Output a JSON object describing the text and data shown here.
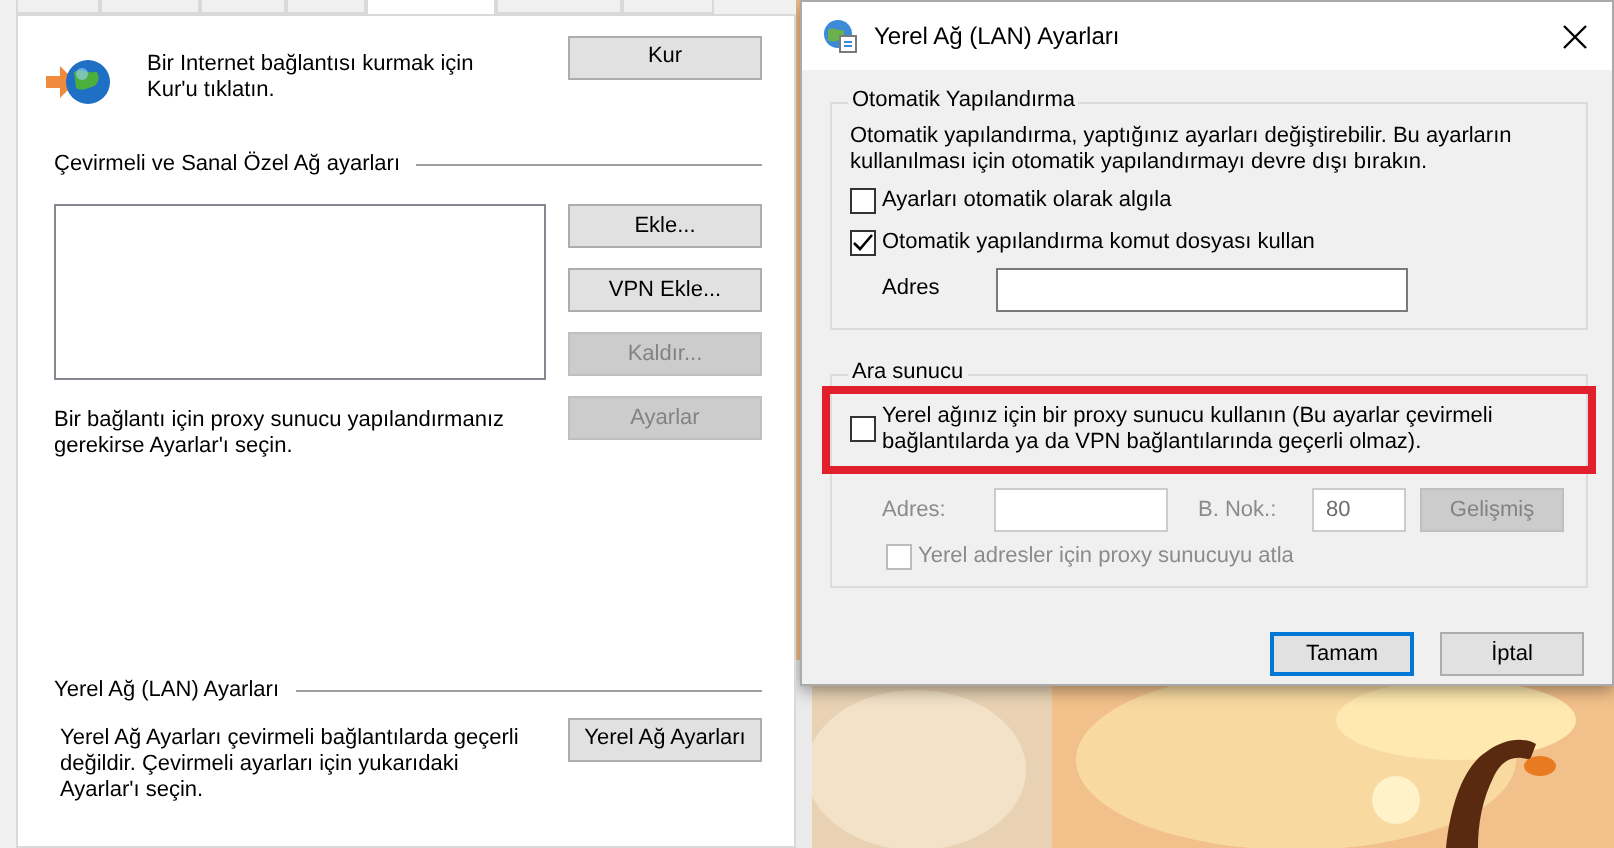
{
  "tabs": [
    {
      "selected": false
    },
    {
      "selected": false
    },
    {
      "selected": false
    },
    {
      "selected": false
    },
    {
      "selected": true
    },
    {
      "selected": false
    },
    {
      "selected": false
    }
  ],
  "connections_panel": {
    "setup_text": "Bir Internet bağlantısı kurmak için Kur'u tıklatın.",
    "setup_button": "Kur",
    "vpn_title": "Çevirmeli ve Sanal Özel Ağ ayarları",
    "vpn_buttons": [
      {
        "label": "Ekle...",
        "disabled": false
      },
      {
        "label": "VPN Ekle...",
        "disabled": false
      },
      {
        "label": "Kaldır...",
        "disabled": true
      },
      {
        "label": "Ayarlar",
        "disabled": true
      }
    ],
    "vpn_note": "Bir bağlantı için proxy sunucu yapılandırmanız gerekirse Ayarlar'ı seçin.",
    "lan_title": "Yerel Ağ (LAN) Ayarları",
    "lan_text": "Yerel Ağ Ayarları çevirmeli bağlantılarda geçerli değildir. Çevirmeli ayarları için yukarıdaki Ayarlar'ı seçin.",
    "lan_button": "Yerel Ağ Ayarları"
  },
  "dialog": {
    "title": "Yerel Ağ (LAN) Ayarları",
    "auto_config": {
      "title": "Otomatik Yapılandırma",
      "description": "Otomatik yapılandırma, yaptığınız ayarları değiştirebilir. Bu ayarların kullanılması için otomatik yapılandırmayı devre dışı bırakın.",
      "options": [
        {
          "label": "Ayarları otomatik olarak algıla",
          "checked": false
        },
        {
          "label": "Otomatik yapılandırma komut dosyası kullan",
          "checked": true
        }
      ],
      "address_label": "Adres"
    },
    "proxy": {
      "title": "Ara sunucu",
      "use_proxy": {
        "label": "Yerel ağınız için bir proxy sunucu kullanın (Bu ayarlar çevirmeli bağlantılarda ya da VPN bağlantılarında geçerli olmaz).",
        "checked": false,
        "highlighted": true
      },
      "disabled": true,
      "address_label": "Adres:",
      "port_label": "B. Nok.:",
      "port_value": "80",
      "advanced_button": "Gelişmiş",
      "bypass": {
        "label": "Yerel adresler için proxy sunucuyu atla",
        "checked": false
      }
    },
    "buttons": [
      {
        "label": "Tamam",
        "default": true
      },
      {
        "label": "İptal",
        "default": false
      }
    ]
  }
}
